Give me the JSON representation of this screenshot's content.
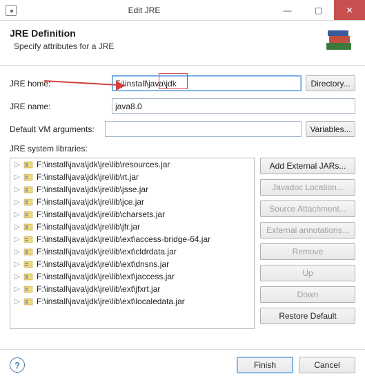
{
  "window": {
    "title": "Edit JRE"
  },
  "header": {
    "title": "JRE Definition",
    "desc": "Specify attributes for a JRE"
  },
  "form": {
    "home_label": "JRE home:",
    "home_value": "F:\\install\\java\\jdk",
    "dir_btn": "Directory...",
    "name_label": "JRE name:",
    "name_value": "java8.0",
    "args_label": "Default VM arguments:",
    "args_value": "",
    "vars_btn": "Variables...",
    "libs_label": "JRE system libraries:"
  },
  "tree": [
    "F:\\install\\java\\jdk\\jre\\lib\\resources.jar",
    "F:\\install\\java\\jdk\\jre\\lib\\rt.jar",
    "F:\\install\\java\\jdk\\jre\\lib\\jsse.jar",
    "F:\\install\\java\\jdk\\jre\\lib\\jce.jar",
    "F:\\install\\java\\jdk\\jre\\lib\\charsets.jar",
    "F:\\install\\java\\jdk\\jre\\lib\\jfr.jar",
    "F:\\install\\java\\jdk\\jre\\lib\\ext\\access-bridge-64.jar",
    "F:\\install\\java\\jdk\\jre\\lib\\ext\\cldrdata.jar",
    "F:\\install\\java\\jdk\\jre\\lib\\ext\\dnsns.jar",
    "F:\\install\\java\\jdk\\jre\\lib\\ext\\jaccess.jar",
    "F:\\install\\java\\jdk\\jre\\lib\\ext\\jfxrt.jar",
    "F:\\install\\java\\jdk\\jre\\lib\\ext\\localedata.jar"
  ],
  "side": {
    "add": "Add External JARs...",
    "javadoc": "Javadoc Location...",
    "source": "Source Attachment...",
    "annot": "External annotations...",
    "remove": "Remove",
    "up": "Up",
    "down": "Down",
    "restore": "Restore Default"
  },
  "footer": {
    "finish": "Finish",
    "cancel": "Cancel"
  }
}
